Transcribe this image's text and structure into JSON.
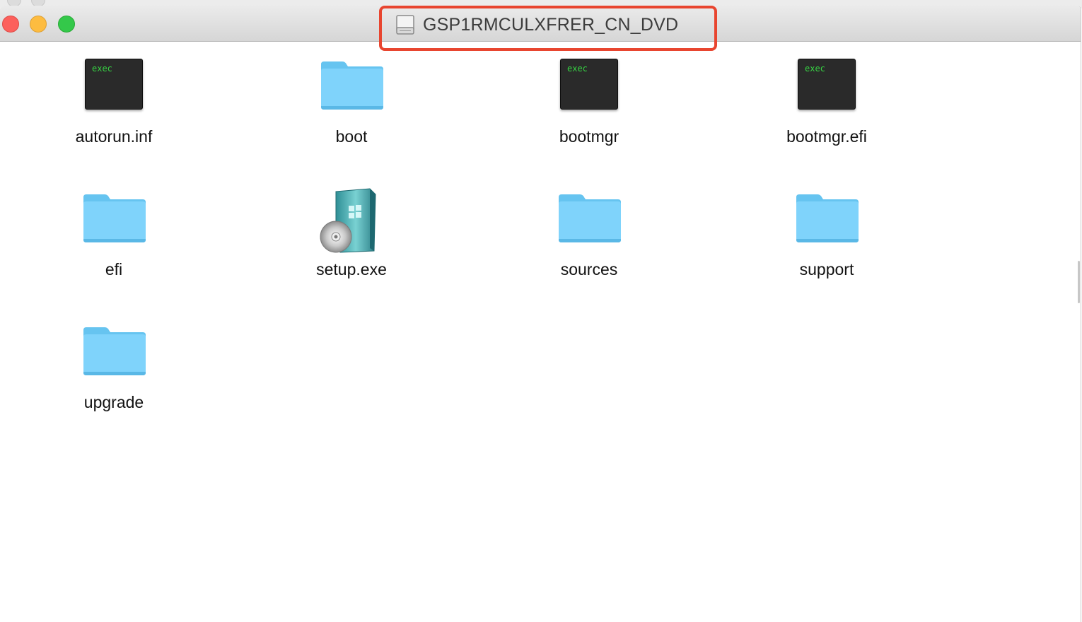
{
  "window": {
    "title": "GSP1RMCULXFRER_CN_DVD",
    "title_icon": "drive-icon",
    "highlight_color": "#e8452f"
  },
  "traffic_lights": {
    "close_color": "#fc605c",
    "minimize_color": "#fdbc40",
    "zoom_color": "#34c84a"
  },
  "files": [
    {
      "name": "autorun.inf",
      "kind": "exec",
      "icon": "exec-icon",
      "icon_text": "exec"
    },
    {
      "name": "boot",
      "kind": "folder",
      "icon": "folder-icon"
    },
    {
      "name": "bootmgr",
      "kind": "exec",
      "icon": "exec-icon",
      "icon_text": "exec"
    },
    {
      "name": "bootmgr.efi",
      "kind": "exec",
      "icon": "exec-icon",
      "icon_text": "exec"
    },
    {
      "name": "efi",
      "kind": "folder",
      "icon": "folder-icon"
    },
    {
      "name": "setup.exe",
      "kind": "installer",
      "icon": "setup-installer-icon"
    },
    {
      "name": "sources",
      "kind": "folder",
      "icon": "folder-icon"
    },
    {
      "name": "support",
      "kind": "folder",
      "icon": "folder-icon"
    },
    {
      "name": "upgrade",
      "kind": "folder",
      "icon": "folder-icon"
    }
  ]
}
